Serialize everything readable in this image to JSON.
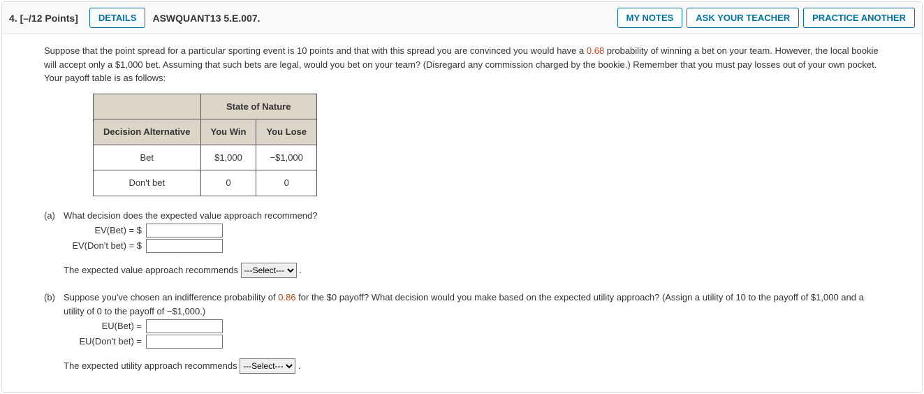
{
  "header": {
    "number": "4.",
    "points": "[–/12 Points]",
    "details_btn": "DETAILS",
    "ref": "ASWQUANT13 5.E.007.",
    "mynotes_btn": "MY NOTES",
    "ask_btn": "ASK YOUR TEACHER",
    "practice_btn": "PRACTICE ANOTHER"
  },
  "intro": {
    "prefix": "Suppose that the point spread for a particular sporting event is 10 points and that with this spread you are convinced you would have a ",
    "prob": "0.68",
    "suffix": " probability of winning a bet on your team. However, the local bookie will accept only a $1,000 bet. Assuming that such bets are legal, would you bet on your team? (Disregard any commission charged by the bookie.) Remember that you must pay losses out of your own pocket. Your payoff table is as follows:"
  },
  "table": {
    "state_header": "State of Nature",
    "decision_header": "Decision Alternative",
    "win": "You Win",
    "lose": "You Lose",
    "row1_label": "Bet",
    "row1_win": "$1,000",
    "row1_lose": "−$1,000",
    "row2_label": "Don't bet",
    "row2_win": "0",
    "row2_lose": "0"
  },
  "partA": {
    "label": "(a)",
    "q": "What decision does the expected value approach recommend?",
    "ev_bet_label": "EV(Bet)  =  $",
    "ev_dont_label": "EV(Don't bet)  =  $",
    "rec_prefix": "The expected value approach recommends ",
    "select_default": "---Select---"
  },
  "partB": {
    "label": "(b)",
    "q_prefix": "Suppose you've chosen an indifference probability of ",
    "prob": "0.86",
    "q_suffix": " for the $0 payoff? What decision would you make based on the expected utility approach? (Assign a utility of 10 to the payoff of $1,000 and a utility of 0 to the payoff of −$1,000.)",
    "eu_bet_label": "EU(Bet)  =  ",
    "eu_dont_label": "EU(Don't bet)  =  ",
    "rec_prefix": "The expected utility approach recommends ",
    "select_default": "---Select---"
  }
}
